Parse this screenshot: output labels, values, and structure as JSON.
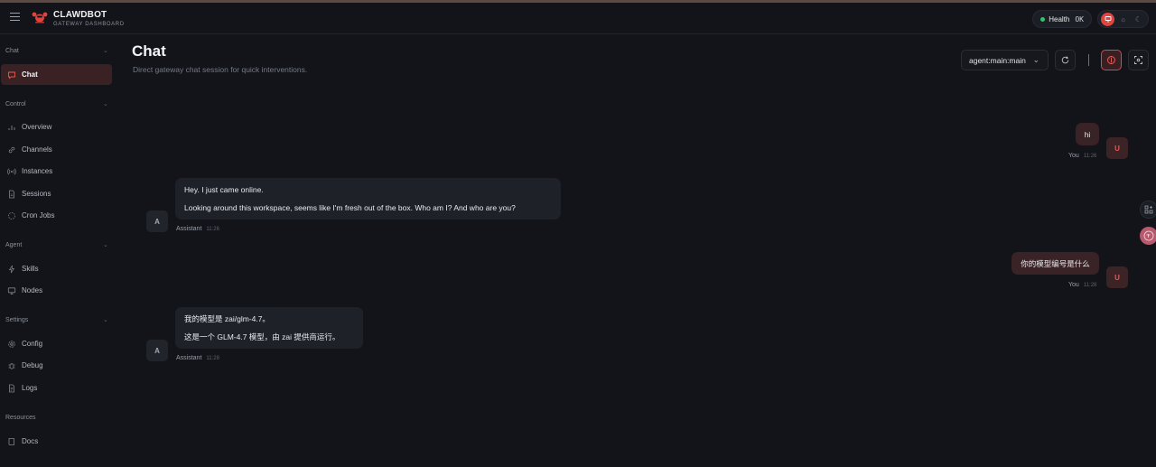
{
  "brand": {
    "name": "CLAWDBOT",
    "subtitle": "GATEWAY DASHBOARD"
  },
  "header": {
    "health_label": "Health",
    "health_status": "OK"
  },
  "sidebar": {
    "sections": [
      {
        "title": "Chat",
        "items": [
          {
            "label": "Chat",
            "icon": "chat-bubble-icon",
            "active": true
          }
        ]
      },
      {
        "title": "Control",
        "items": [
          {
            "label": "Overview",
            "icon": "bar-chart-icon"
          },
          {
            "label": "Channels",
            "icon": "link-icon"
          },
          {
            "label": "Instances",
            "icon": "radio-icon"
          },
          {
            "label": "Sessions",
            "icon": "document-icon"
          },
          {
            "label": "Cron Jobs",
            "icon": "loader-icon"
          }
        ]
      },
      {
        "title": "Agent",
        "items": [
          {
            "label": "Skills",
            "icon": "zap-icon"
          },
          {
            "label": "Nodes",
            "icon": "monitor-icon"
          }
        ]
      },
      {
        "title": "Settings",
        "items": [
          {
            "label": "Config",
            "icon": "gear-icon"
          },
          {
            "label": "Debug",
            "icon": "bug-icon"
          },
          {
            "label": "Logs",
            "icon": "file-text-icon"
          }
        ]
      },
      {
        "title": "Resources",
        "items": [
          {
            "label": "Docs",
            "icon": "book-icon"
          }
        ]
      }
    ]
  },
  "main": {
    "title": "Chat",
    "subtitle": "Direct gateway chat session for quick interventions.",
    "session_value": "agent:main:main"
  },
  "messages": [
    {
      "role": "user",
      "avatar": "U",
      "lines": [
        "hi"
      ],
      "author": "You",
      "time": "11:26"
    },
    {
      "role": "assistant",
      "avatar": "A",
      "lines": [
        "Hey. I just came online.",
        "Looking around this workspace, seems like I'm fresh out of the box. Who am I? And who are you?"
      ],
      "author": "Assistant",
      "time": "11:26"
    },
    {
      "role": "user",
      "avatar": "U",
      "lines": [
        "你的模型编号是什么"
      ],
      "author": "You",
      "time": "11:28"
    },
    {
      "role": "assistant",
      "avatar": "A",
      "lines": [
        "我的模型是 zai/glm-4.7。",
        "这是一个 GLM-4.7 模型，由 zai 提供商运行。"
      ],
      "author": "Assistant",
      "time": "11:28"
    }
  ],
  "colors": {
    "accent": "#e0443e",
    "user_bubble": "#3a2326",
    "assistant_bubble": "#1f2129",
    "health_dot": "#2fc46b"
  }
}
